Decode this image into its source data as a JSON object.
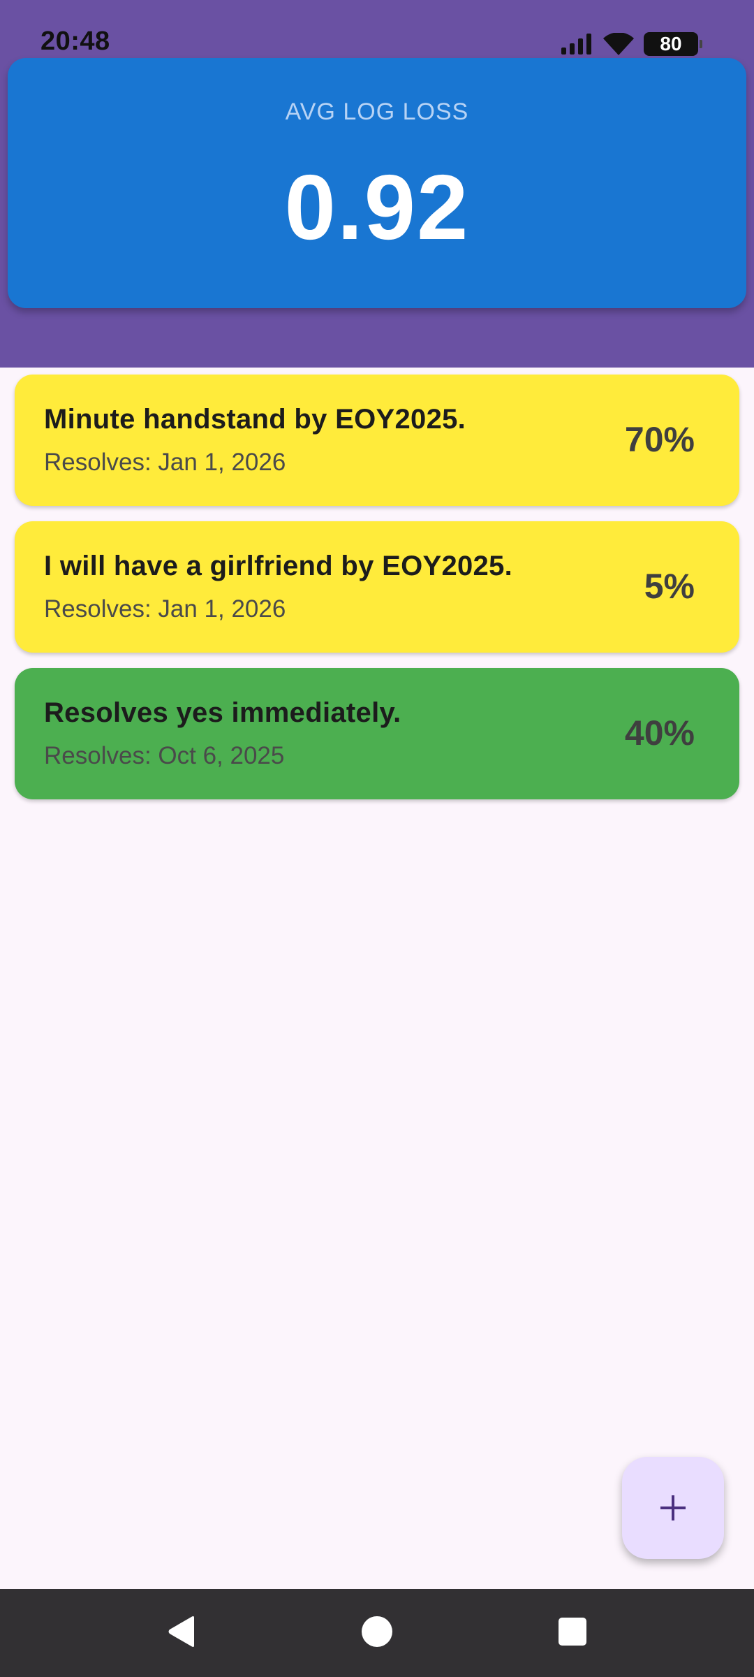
{
  "status_bar": {
    "time": "20:48",
    "battery": "80",
    "icons": [
      "signal-icon",
      "wifi-icon",
      "battery-icon"
    ]
  },
  "stats": {
    "label": "AVG LOG LOSS",
    "value": "0.92"
  },
  "predictions": [
    {
      "title": "Minute handstand by EOY2025.",
      "resolves": "Resolves: Jan 1, 2026",
      "probability": "70%",
      "color": "#ffeb3b"
    },
    {
      "title": "I will have a girlfriend by EOY2025.",
      "resolves": "Resolves: Jan 1, 2026",
      "probability": "5%",
      "color": "#ffeb3b"
    },
    {
      "title": "Resolves yes immediately.",
      "resolves": "Resolves: Oct 6, 2025",
      "probability": "40%",
      "color": "#4caf50"
    }
  ],
  "fab": {
    "icon": "plus-icon"
  },
  "nav": {
    "icons": [
      "back-icon",
      "home-icon",
      "recents-icon"
    ]
  },
  "colors": {
    "header_bg": "#6a51a3",
    "stats_card_bg": "#1976d2",
    "page_bg": "#fcf5fc",
    "pending_card": "#ffeb3b",
    "resolved_yes_card": "#4caf50",
    "fab_bg": "#e9ddff",
    "nav_bg": "#323033"
  }
}
